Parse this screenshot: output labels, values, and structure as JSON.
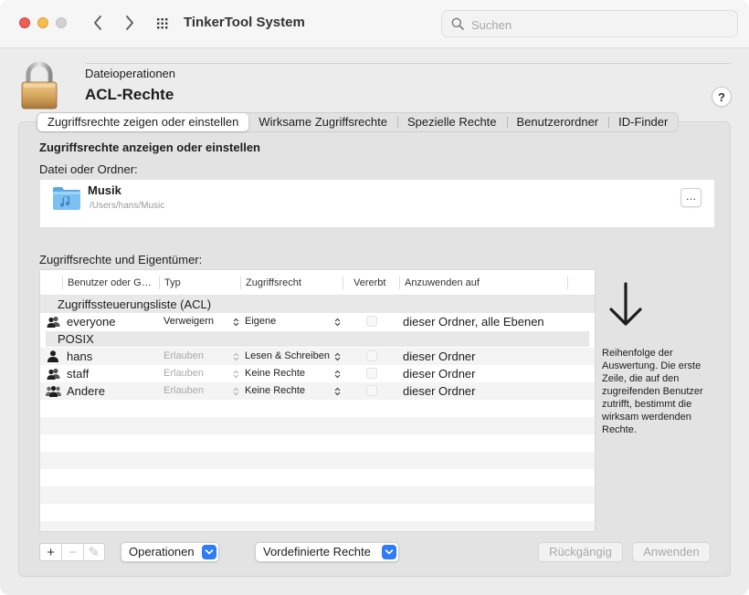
{
  "window": {
    "app_title": "TinkerTool System",
    "search_placeholder": "Suchen"
  },
  "header": {
    "subtitle": "Dateioperationen",
    "title": "ACL-Rechte",
    "help_label": "?"
  },
  "tabs": [
    {
      "label": "Zugriffsrechte zeigen oder einstellen",
      "active": true
    },
    {
      "label": "Wirksame Zugriffsrechte",
      "active": false
    },
    {
      "label": "Spezielle Rechte",
      "active": false
    },
    {
      "label": "Benutzerordner",
      "active": false
    },
    {
      "label": "ID-Finder",
      "active": false
    }
  ],
  "panel": {
    "group_title": "Zugriffsrechte anzeigen oder einstellen",
    "file_label": "Datei oder Ordner:",
    "file": {
      "name": "Musik",
      "path": "/Users/hans/Music",
      "more_label": "…"
    },
    "perm_label": "Zugriffsrechte und Eigentümer:"
  },
  "table": {
    "columns": [
      "Benutzer oder G…",
      "Typ",
      "Zugriffsrecht",
      "Vererbt",
      "Anzuwenden auf"
    ],
    "acl_group": "Zugriffssteuerungsliste (ACL)",
    "acl_rows": [
      {
        "user": "everyone",
        "icon": "group-icon",
        "type": "Verweigern",
        "type_dim": false,
        "perm": "Eigene",
        "inherited": false,
        "apply": "dieser Ordner, alle Ebenen"
      }
    ],
    "posix_group": "POSIX",
    "posix_rows": [
      {
        "user": "hans",
        "icon": "user-icon",
        "type": "Erlauben",
        "type_dim": true,
        "perm": "Lesen & Schreiben",
        "inherited": false,
        "apply": "dieser Ordner"
      },
      {
        "user": "staff",
        "icon": "group-icon",
        "type": "Erlauben",
        "type_dim": true,
        "perm": "Keine Rechte",
        "inherited": false,
        "apply": "dieser Ordner"
      },
      {
        "user": "Andere",
        "icon": "everyone-icon",
        "type": "Erlauben",
        "type_dim": true,
        "perm": "Keine Rechte",
        "inherited": false,
        "apply": "dieser Ordner"
      }
    ]
  },
  "hint": "Reihenfolge der Auswertung. Die erste Zeile, die auf den zugreifenden Benutzer zutrifft, bestimmt die wirksam werdenden Rechte.",
  "bottom": {
    "add_label": "+",
    "remove_label": "−",
    "edit_label": "✎",
    "operations_label": "Operationen",
    "predefined_label": "Vordefinierte Rechte",
    "undo_label": "Rückgängig",
    "apply_label": "Anwenden"
  },
  "colors": {
    "accent": "#2f7cf6",
    "traffic_red": "#ee5e57",
    "traffic_yellow": "#f5be4f",
    "traffic_gray": "#d1d1d1"
  }
}
